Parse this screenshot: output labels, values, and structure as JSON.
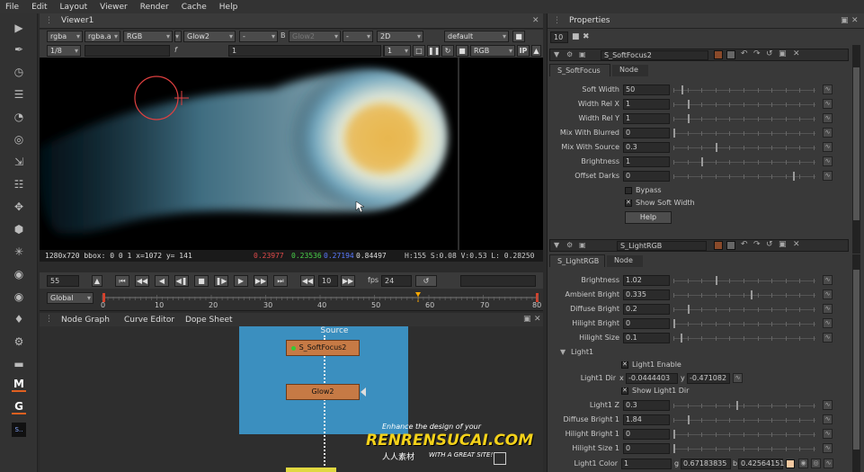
{
  "menu": [
    "File",
    "Edit",
    "Layout",
    "Viewer",
    "Render",
    "Cache",
    "Help"
  ],
  "toolbar_icons": [
    "pointer-icon",
    "paint-icon",
    "time-icon",
    "channel-icon",
    "color-icon",
    "filter-icon",
    "keyer-icon",
    "merge-icon",
    "transform-icon",
    "3d-icon",
    "particles-icon",
    "deep-icon",
    "views-icon",
    "metadata-icon",
    "toolsets-icon",
    "other-icon",
    "m-icon",
    "g-icon",
    "logo-icon"
  ],
  "toolbar_labels": {
    "m": "M",
    "g": "G",
    "s": "S.."
  },
  "viewer": {
    "tab": "Viewer1",
    "row1": {
      "channels": "rgba",
      "channel2": "rgba.a",
      "colorspace": "RGB",
      "input_a": "Glow2",
      "dash": "-",
      "b_label": "B",
      "input_b": "Glow2",
      "compare": "-",
      "view": "2D",
      "lut": "default"
    },
    "row2": {
      "frame_prefix": "1/8",
      "frame_value": "1",
      "gain_label": "f",
      "gain_value": "1",
      "y_label": "Y",
      "y_value": "1",
      "proxy": "RGB",
      "ip": "IP"
    },
    "info": {
      "format": "1280x720 bbox: 0 0 1  x=1072 y= 141",
      "r": "0.23977",
      "g": "0.23536",
      "b": "0.27194",
      "a": "0.84497",
      "hsv": "H:155 S:0.08 V:0.53  L: 0.28250"
    },
    "transport": {
      "frame": "55",
      "step": "10",
      "fps_label": "fps",
      "fps": "24",
      "range_mode": "Global"
    },
    "timeline_ticks": [
      "0",
      "10",
      "20",
      "30",
      "40",
      "50",
      "60",
      "70",
      "80"
    ],
    "overlay_title": ""
  },
  "nodegraph": {
    "tabs": [
      "Node Graph",
      "Curve Editor",
      "Dope Sheet"
    ],
    "nodes": {
      "source": "Source",
      "softfocus": "S_SoftFocus2",
      "glow": "Glow2"
    }
  },
  "properties": {
    "title": "Properties",
    "count": "10",
    "panel1": {
      "name": "S_SoftFocus2",
      "tabs": [
        "S_SoftFocus",
        "Node"
      ],
      "params": [
        {
          "label": "Soft Width",
          "value": "50",
          "knob": 0.06
        },
        {
          "label": "Width Rel X",
          "value": "1",
          "knob": 0.1
        },
        {
          "label": "Width Rel Y",
          "value": "1",
          "knob": 0.1
        },
        {
          "label": "Mix With Blurred",
          "value": "0",
          "knob": 0
        },
        {
          "label": "Mix With Source",
          "value": "0.3",
          "knob": 0.3
        },
        {
          "label": "Brightness",
          "value": "1",
          "knob": 0.2
        },
        {
          "label": "Offset Darks",
          "value": "0",
          "knob": 0.85
        }
      ],
      "bypass_label": "Bypass",
      "show_soft_width_label": "Show Soft Width",
      "help_label": "Help"
    },
    "panel2": {
      "name": "S_LightRGB",
      "tabs": [
        "S_LightRGB",
        "Node"
      ],
      "params": [
        {
          "label": "Brightness",
          "value": "1.02",
          "knob": 0.3
        },
        {
          "label": "Ambient Bright",
          "value": "0.335",
          "knob": 0.55
        },
        {
          "label": "Diffuse Bright",
          "value": "0.2",
          "knob": 0.1
        },
        {
          "label": "Hilight Bright",
          "value": "0",
          "knob": 0
        },
        {
          "label": "Hilight Size",
          "value": "0.1",
          "knob": 0.05
        }
      ],
      "section": "Light1",
      "light1_enable": "Light1 Enable",
      "light1_dir_label": "Light1 Dir",
      "light1_dir_x_label": "x",
      "light1_dir_x": "-0.0444403",
      "light1_dir_y_label": "y",
      "light1_dir_y": "-0.471082",
      "show_light1_dir": "Show Light1 Dir",
      "params2": [
        {
          "label": "Light1 Z",
          "value": "0.3",
          "knob": 0.45
        },
        {
          "label": "Diffuse Bright 1",
          "value": "1.84",
          "knob": 0.1
        },
        {
          "label": "Hilight Bright 1",
          "value": "0",
          "knob": 0
        },
        {
          "label": "Hilight Size 1",
          "value": "0",
          "knob": 0
        }
      ],
      "color_label": "Light1 Color",
      "color_r": "1",
      "color_g_label": "g",
      "color_g": "0.67183835",
      "color_b_label": "b",
      "color_b": "0.42564151"
    }
  },
  "watermark": {
    "line1": "Enhance the design of your",
    "line2": "RENRENSUCAI.COM",
    "line3": "人人素材",
    "line4": "WITH A GREAT SITE!"
  },
  "colors": {
    "accent": "#ffaa00",
    "node_orange": "#c67a45",
    "backdrop": "#3b8fbf",
    "timeline_red": "#c0392b"
  }
}
